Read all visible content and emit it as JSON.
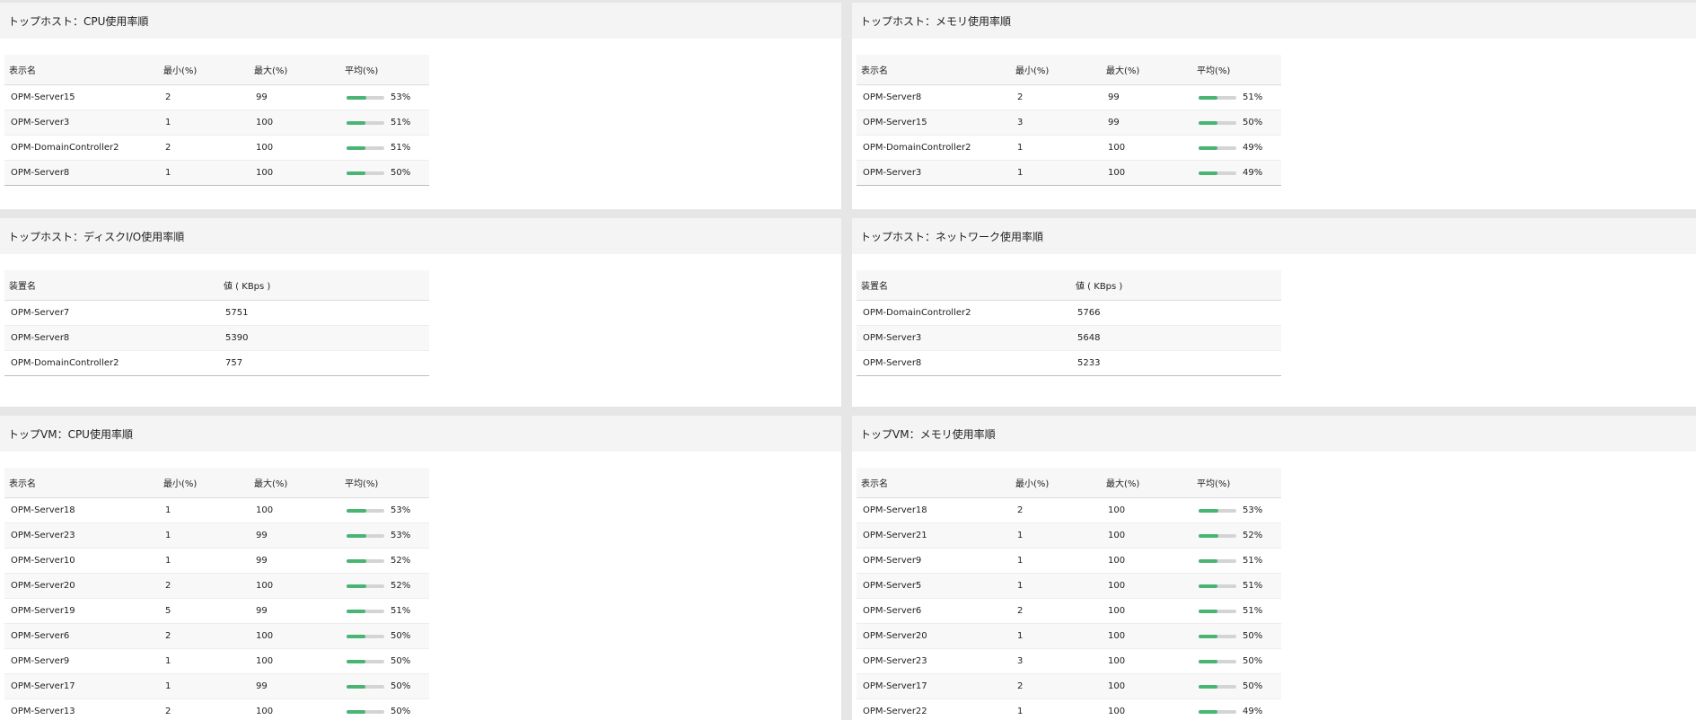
{
  "colors": {
    "bar_fill": "#4ab573",
    "bar_track": "#d4d4d4"
  },
  "panels": {
    "host_cpu": {
      "title": "トップホスト：CPU使用率順",
      "headers": [
        "表示名",
        "最小(%)",
        "最大(%)",
        "平均(%)"
      ],
      "rows": [
        {
          "name": "OPM-Server15",
          "min": "2",
          "max": "99",
          "avg": 53,
          "avg_label": "53%"
        },
        {
          "name": "OPM-Server3",
          "min": "1",
          "max": "100",
          "avg": 51,
          "avg_label": "51%"
        },
        {
          "name": "OPM-DomainController2",
          "min": "2",
          "max": "100",
          "avg": 51,
          "avg_label": "51%"
        },
        {
          "name": "OPM-Server8",
          "min": "1",
          "max": "100",
          "avg": 50,
          "avg_label": "50%"
        }
      ]
    },
    "host_mem": {
      "title": "トップホスト：メモリ使用率順",
      "headers": [
        "表示名",
        "最小(%)",
        "最大(%)",
        "平均(%)"
      ],
      "rows": [
        {
          "name": "OPM-Server8",
          "min": "2",
          "max": "99",
          "avg": 51,
          "avg_label": "51%"
        },
        {
          "name": "OPM-Server15",
          "min": "3",
          "max": "99",
          "avg": 50,
          "avg_label": "50%"
        },
        {
          "name": "OPM-DomainController2",
          "min": "1",
          "max": "100",
          "avg": 49,
          "avg_label": "49%"
        },
        {
          "name": "OPM-Server3",
          "min": "1",
          "max": "100",
          "avg": 49,
          "avg_label": "49%"
        }
      ]
    },
    "host_disk": {
      "title": "トップホスト：ディスクI/O使用率順",
      "headers": [
        "装置名",
        "値 ( KBps )"
      ],
      "rows": [
        {
          "name": "OPM-Server7",
          "value": "5751"
        },
        {
          "name": "OPM-Server8",
          "value": "5390"
        },
        {
          "name": "OPM-DomainController2",
          "value": "757"
        }
      ]
    },
    "host_net": {
      "title": "トップホスト：ネットワーク使用率順",
      "headers": [
        "装置名",
        "値 ( KBps )"
      ],
      "rows": [
        {
          "name": "OPM-DomainController2",
          "value": "5766"
        },
        {
          "name": "OPM-Server3",
          "value": "5648"
        },
        {
          "name": "OPM-Server8",
          "value": "5233"
        }
      ]
    },
    "vm_cpu": {
      "title": "トップVM：CPU使用率順",
      "headers": [
        "表示名",
        "最小(%)",
        "最大(%)",
        "平均(%)"
      ],
      "rows": [
        {
          "name": "OPM-Server18",
          "min": "1",
          "max": "100",
          "avg": 53,
          "avg_label": "53%"
        },
        {
          "name": "OPM-Server23",
          "min": "1",
          "max": "99",
          "avg": 53,
          "avg_label": "53%"
        },
        {
          "name": "OPM-Server10",
          "min": "1",
          "max": "99",
          "avg": 52,
          "avg_label": "52%"
        },
        {
          "name": "OPM-Server20",
          "min": "2",
          "max": "100",
          "avg": 52,
          "avg_label": "52%"
        },
        {
          "name": "OPM-Server19",
          "min": "5",
          "max": "99",
          "avg": 51,
          "avg_label": "51%"
        },
        {
          "name": "OPM-Server6",
          "min": "2",
          "max": "100",
          "avg": 50,
          "avg_label": "50%"
        },
        {
          "name": "OPM-Server9",
          "min": "1",
          "max": "100",
          "avg": 50,
          "avg_label": "50%"
        },
        {
          "name": "OPM-Server17",
          "min": "1",
          "max": "99",
          "avg": 50,
          "avg_label": "50%"
        },
        {
          "name": "OPM-Server13",
          "min": "2",
          "max": "100",
          "avg": 50,
          "avg_label": "50%"
        }
      ]
    },
    "vm_mem": {
      "title": "トップVM：メモリ使用率順",
      "headers": [
        "表示名",
        "最小(%)",
        "最大(%)",
        "平均(%)"
      ],
      "rows": [
        {
          "name": "OPM-Server18",
          "min": "2",
          "max": "100",
          "avg": 53,
          "avg_label": "53%"
        },
        {
          "name": "OPM-Server21",
          "min": "1",
          "max": "100",
          "avg": 52,
          "avg_label": "52%"
        },
        {
          "name": "OPM-Server9",
          "min": "1",
          "max": "100",
          "avg": 51,
          "avg_label": "51%"
        },
        {
          "name": "OPM-Server5",
          "min": "1",
          "max": "100",
          "avg": 51,
          "avg_label": "51%"
        },
        {
          "name": "OPM-Server6",
          "min": "2",
          "max": "100",
          "avg": 51,
          "avg_label": "51%"
        },
        {
          "name": "OPM-Server20",
          "min": "1",
          "max": "100",
          "avg": 50,
          "avg_label": "50%"
        },
        {
          "name": "OPM-Server23",
          "min": "3",
          "max": "100",
          "avg": 50,
          "avg_label": "50%"
        },
        {
          "name": "OPM-Server17",
          "min": "2",
          "max": "100",
          "avg": 50,
          "avg_label": "50%"
        },
        {
          "name": "OPM-Server22",
          "min": "1",
          "max": "100",
          "avg": 49,
          "avg_label": "49%"
        }
      ]
    }
  }
}
